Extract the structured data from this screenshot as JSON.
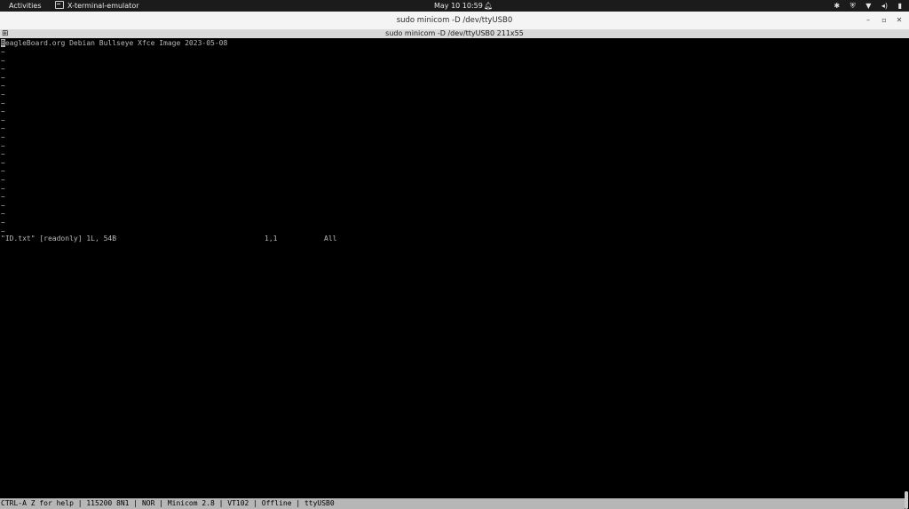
{
  "topbar": {
    "activities": "Activities",
    "app_name": "X-terminal-emulator",
    "clock": "May 10  10:59",
    "bell_icon": "bell-icon",
    "tray_icons": [
      "accessibility-icon",
      "shield-icon",
      "wifi-icon",
      "volume-icon",
      "battery-icon"
    ]
  },
  "window": {
    "title": "sudo minicom -D /dev/ttyUSB0",
    "tab_title": "sudo minicom -D /dev/ttyUSB0 211x55",
    "buttons": {
      "minimize": "–",
      "maximize": "▫",
      "close": "✕"
    }
  },
  "terminal": {
    "first_char": "B",
    "first_line_rest": "eagleBoard.org Debian Bullseye Xfce Image 2023-05-08",
    "tilde": "~",
    "tilde_count": 22,
    "vim_status": {
      "file": "\"ID.txt\" [readonly] 1L, 54B",
      "position": "1,1",
      "scroll": "All"
    }
  },
  "statusbar": {
    "text": "CTRL-A Z for help | 115200 8N1 | NOR | Minicom 2.8 | VT102 | Offline | ttyUSB0"
  },
  "colors": {
    "terminal_bg": "#000000",
    "terminal_fg": "#b8b8b8",
    "statusbar_bg": "#b6b6b6",
    "topbar_bg": "#1b1b1b",
    "titlebar_bg": "#f4f4f4"
  }
}
